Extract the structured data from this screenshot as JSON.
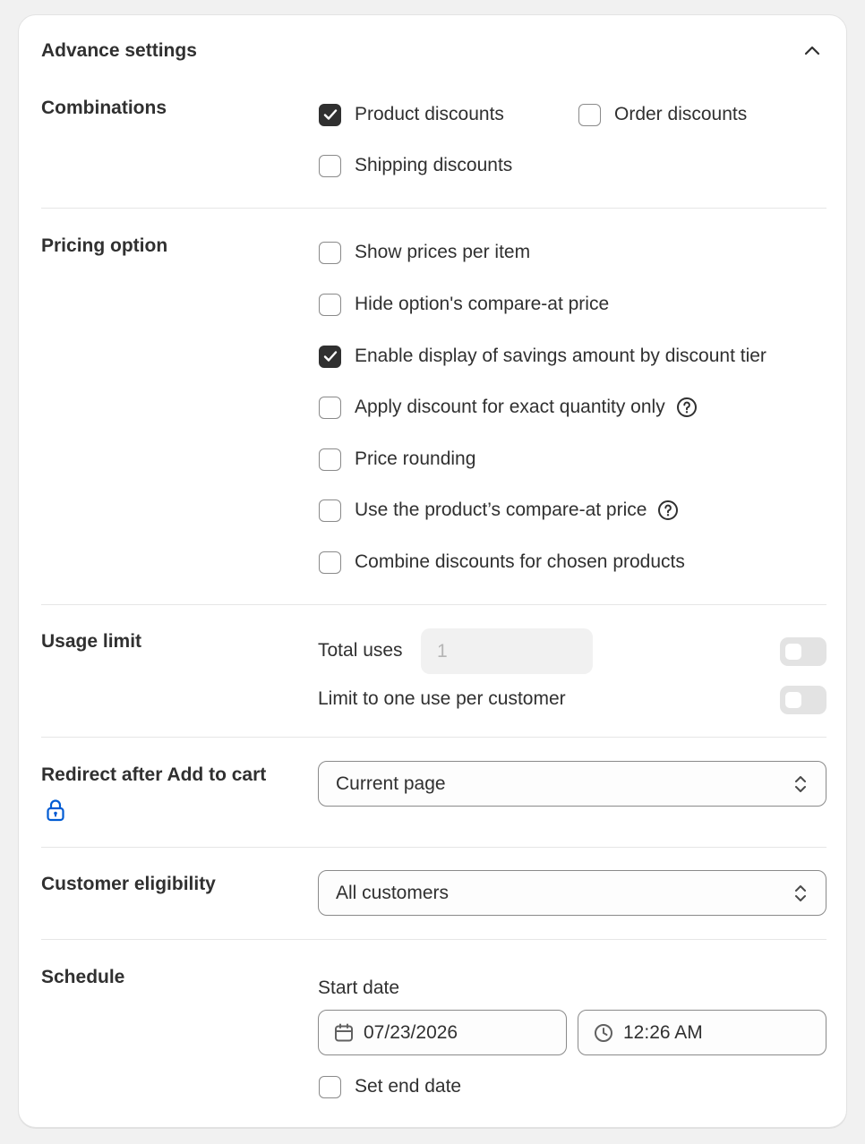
{
  "card": {
    "title": "Advance settings"
  },
  "combinations": {
    "label": "Combinations",
    "options": [
      {
        "label": "Product discounts",
        "checked": true
      },
      {
        "label": "Order discounts",
        "checked": false
      },
      {
        "label": "Shipping discounts",
        "checked": false
      }
    ]
  },
  "pricing": {
    "label": "Pricing option",
    "options": [
      {
        "label": "Show prices per item",
        "checked": false
      },
      {
        "label": "Hide option's compare-at price",
        "checked": false
      },
      {
        "label": "Enable display of savings amount by discount tier",
        "checked": true
      },
      {
        "label": "Apply discount for exact quantity only",
        "checked": false
      },
      {
        "label": "Price rounding",
        "checked": false
      },
      {
        "label": "Use the product’s compare-at price",
        "checked": false
      },
      {
        "label": "Combine discounts for chosen products",
        "checked": false
      }
    ]
  },
  "usage": {
    "label": "Usage limit",
    "total_uses_label": "Total uses",
    "total_uses_value": "1",
    "one_per_customer_label": "Limit to one use per customer"
  },
  "redirect": {
    "label": "Redirect after Add to cart",
    "value": "Current page"
  },
  "eligibility": {
    "label": "Customer eligibility",
    "value": "All customers"
  },
  "schedule": {
    "label": "Schedule",
    "start_date_label": "Start date",
    "date_value": "07/23/2026",
    "time_value": "12:26 AM",
    "end_date_label": "Set end date"
  },
  "icons": {
    "collapse": "chevron-up-icon",
    "help": "question-circle-icon",
    "lock": "lock-icon",
    "calendar": "calendar-icon",
    "clock": "clock-icon",
    "select": "select-chevrons-icon"
  },
  "colors": {
    "accent_dark": "#303030",
    "lock_blue": "#005bd3"
  }
}
